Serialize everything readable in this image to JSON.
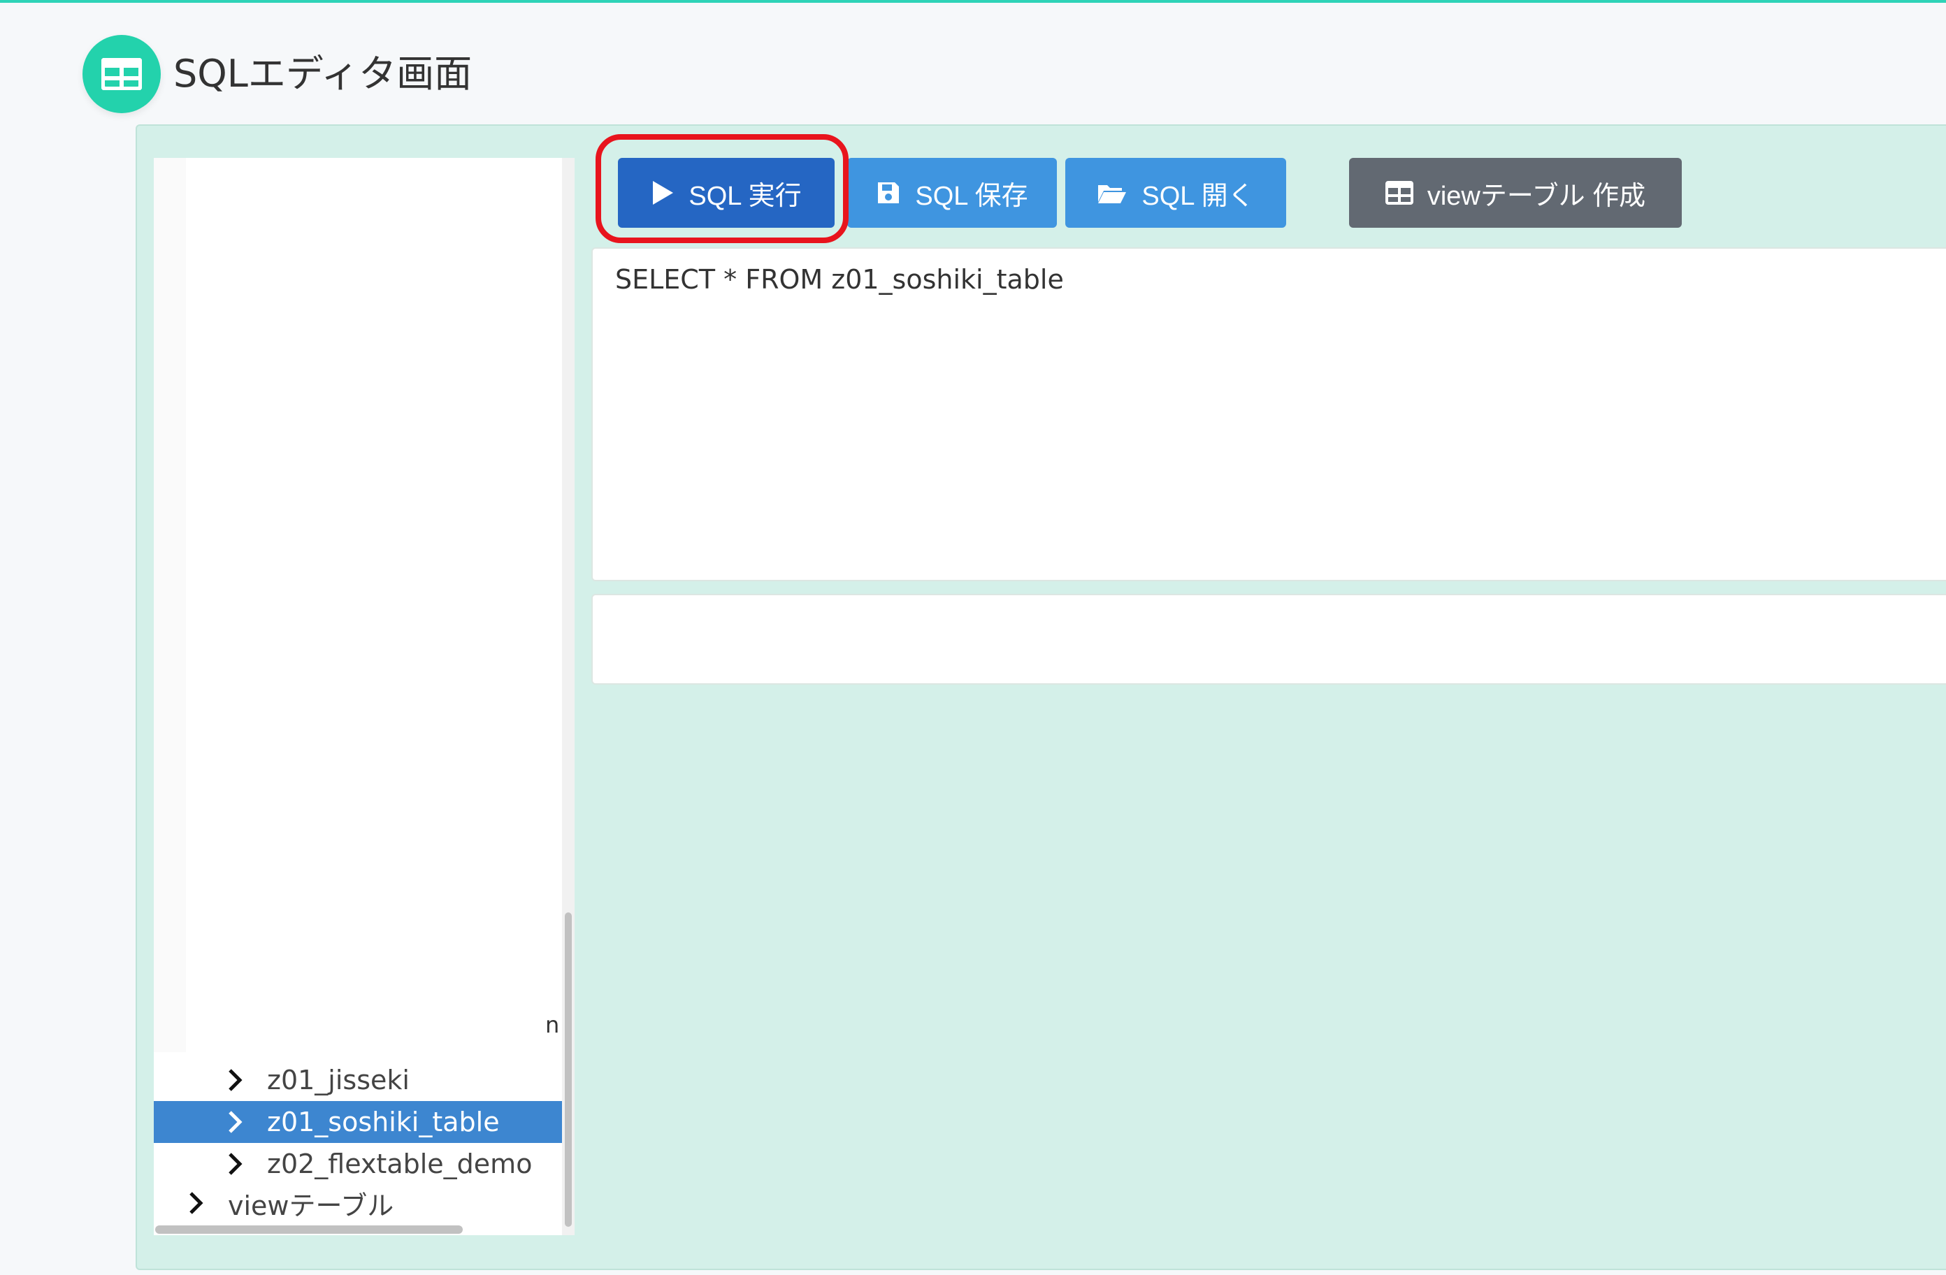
{
  "header": {
    "title": "SQLエディタ画面",
    "icon": "table-grid-icon",
    "accent_color": "#23d2ac"
  },
  "toolbar": {
    "run_label": "SQL 実行",
    "save_label": "SQL 保存",
    "open_label": "SQL 開く",
    "create_view_label": "viewテーブル 作成",
    "run_color": "#2566c3",
    "save_color": "#3f95e0",
    "open_color": "#3f95e0",
    "create_view_color": "#626972",
    "highlight_color": "#e8141d"
  },
  "editor": {
    "sql": "SELECT * FROM z01_soshiki_table"
  },
  "tree": {
    "clipped_top_text": "",
    "clipped_side_text": "n",
    "items": [
      {
        "label": "z01_jisseki",
        "level": 2,
        "selected": false
      },
      {
        "label": "z01_soshiki_table",
        "level": 2,
        "selected": true
      },
      {
        "label": "z02_flextable_demo",
        "level": 2,
        "selected": false
      },
      {
        "label": "viewテーブル",
        "level": 1,
        "selected": false
      }
    ]
  }
}
